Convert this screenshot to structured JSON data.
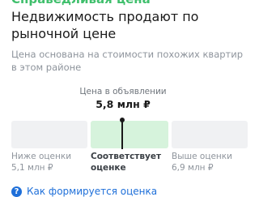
{
  "header": {
    "banner": "Справедливая цена",
    "title": "Недвижимость продают по рыночной цене",
    "description": "Цена основана на стоимости похожих квартир в этом районе"
  },
  "price": {
    "caption": "Цена в объявлении",
    "value": "5,8 млн ₽"
  },
  "scale": {
    "low": {
      "label": "Ниже оценки",
      "value": "5,1 млн ₽"
    },
    "fair": {
      "label": "Соответствует оценке"
    },
    "high": {
      "label": "Выше оценки",
      "value": "6,9 млн ₽"
    }
  },
  "help": {
    "icon": "question-icon",
    "icon_glyph": "?",
    "link": "Как формируется оценка"
  },
  "colors": {
    "accent_green": "#3fbf6c",
    "fair_segment": "#d6f3dc",
    "link_blue": "#1e6fd9"
  }
}
